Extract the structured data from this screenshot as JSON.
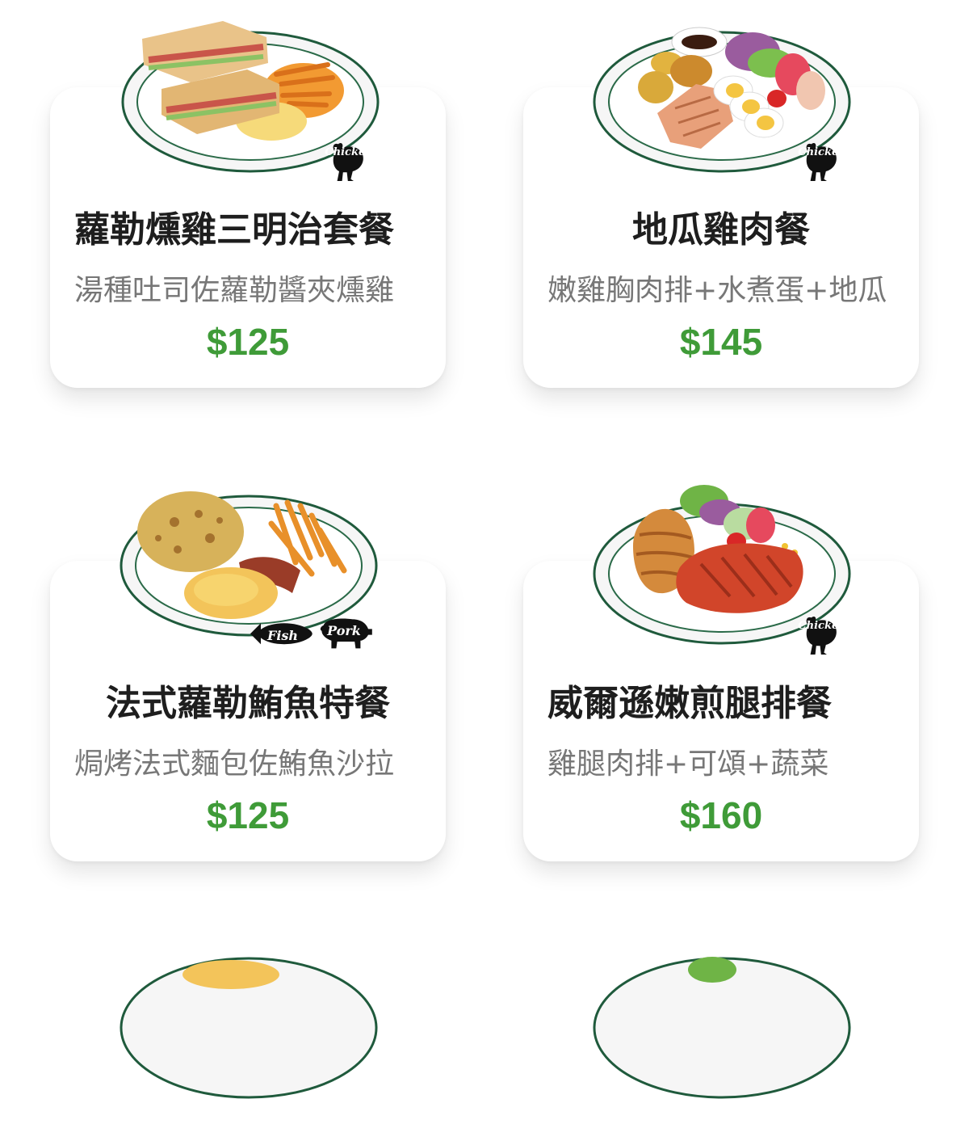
{
  "menu": {
    "items": [
      {
        "name": "蘿勒燻雞三明治套餐",
        "desc": "湯種吐司佐蘿勒醬夾燻雞",
        "price": "$125",
        "tags": [
          "Chicken"
        ]
      },
      {
        "name": "地瓜雞肉餐",
        "desc": "嫩雞胸肉排+水煮蛋+地瓜",
        "price": "$145",
        "tags": [
          "Chicken"
        ]
      },
      {
        "name": "法式蘿勒鮪魚特餐",
        "desc": "焗烤法式麵包佐鮪魚沙拉",
        "price": "$125",
        "tags": [
          "Fish",
          "Pork"
        ]
      },
      {
        "name": "威爾遜嫩煎腿排餐",
        "desc": "雞腿肉排+可頌+蔬菜",
        "price": "$160",
        "tags": [
          "Chicken"
        ]
      }
    ]
  },
  "colors": {
    "price": "#3f9b38",
    "plate_rim": "#1f5a3c",
    "card_bg": "#ffffff"
  },
  "icons": [
    "chicken-icon",
    "fish-icon",
    "pig-icon"
  ]
}
